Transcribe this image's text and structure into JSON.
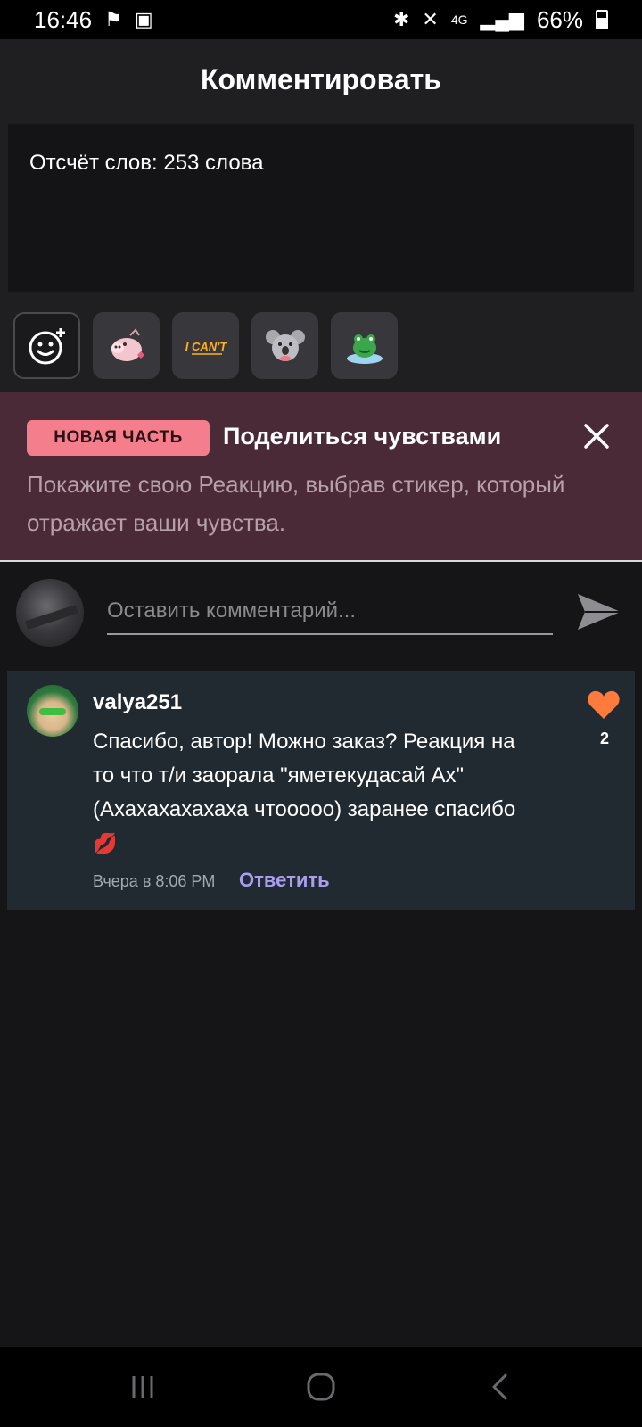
{
  "status_bar": {
    "time": "16:46",
    "battery": "66%",
    "network": "4G"
  },
  "header": {
    "title": "Комментировать"
  },
  "editor": {
    "word_count": "Отсчёт слов: 253 слова"
  },
  "stickers": [
    {
      "name": "emoji-picker",
      "icon": "smiley-plus-icon"
    },
    {
      "name": "sticker-pig",
      "icon": "pig-sticker"
    },
    {
      "name": "sticker-i-cant",
      "icon": "i-cant-sticker"
    },
    {
      "name": "sticker-koala",
      "icon": "koala-sticker"
    },
    {
      "name": "sticker-frog",
      "icon": "frog-sticker"
    }
  ],
  "banner": {
    "badge": "НОВАЯ ЧАСТЬ",
    "title": "Поделиться чувствами",
    "text": "Покажите свою Реакцию, выбрав стикер, который отражает ваши чувства."
  },
  "comment_input": {
    "placeholder": "Оставить комментарий..."
  },
  "comment": {
    "username": "valya251",
    "text": "Спасибо, автор! Можно заказ? Реакция на то что т/и заорала \"яметекудасай Ах\" (Ахахахахахаха чтооооо) заранее спасибо",
    "emoji": "💋",
    "time": "Вчера в 8:06 PM",
    "reply_label": "Ответить",
    "likes": "2"
  },
  "colors": {
    "accent_badge": "#f47e8b",
    "banner_bg": "#4a2a36",
    "comment_card_bg": "#212a31",
    "reply_link": "#a99ef0",
    "like_heart": "#ff7a3d"
  }
}
